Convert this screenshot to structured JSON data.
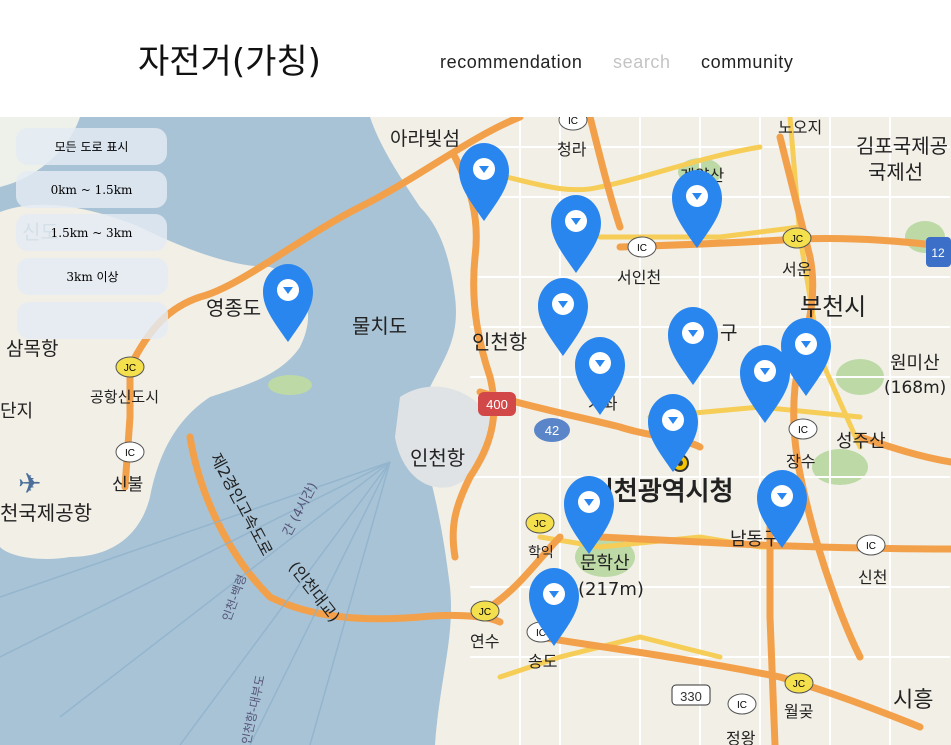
{
  "header": {
    "brand": "자전거(가칭)",
    "nav": {
      "recommendation": "recommendation",
      "search": "search",
      "community": "community"
    }
  },
  "filters": [
    "모든 도로 표시",
    "0km ~ 1.5km",
    "1.5km ~ 3km",
    "3km 이상",
    ""
  ],
  "map": {
    "labels": {
      "arabit": "아라빛섬",
      "cheongna": "청라",
      "noosiji": "노오지",
      "gimpo_airport": "김포국제공",
      "gimpo_intl": "국제선",
      "gyeyangsan": "계양산",
      "seoincheon": "서인천",
      "seoun": "서운",
      "bucheon": "부천시",
      "yeongjongdo": "영종도",
      "mulchido": "물치도",
      "incheonhang1": "인천항",
      "samokhang": "삼목항",
      "gonghang_city": "공항신도시",
      "gu": "구",
      "gajwa": "가좌",
      "wonmisan": "원미산",
      "wonmisan_height": "(168m)",
      "danji": "단지",
      "incheonhang2": "인천항",
      "seongjusan": "성주산",
      "jangsu": "장수",
      "sinbul": "신불",
      "incheon_city_hall": "인천광역시청",
      "airport_intl": "천국제공항",
      "expressway": "제2경인고속도로",
      "incheon_bridge": "(인천대교)",
      "bridge_aux": "간 (4시간)",
      "route_white": "인천-백령",
      "route_daebudo": "인천항-대부도",
      "munhaksan": "문학산",
      "munhaksan_height": "(217m)",
      "hakik": "학익",
      "namdong": "남동구",
      "sincheon": "신천",
      "yeonsu": "연수",
      "songdo": "송도",
      "wolgot": "월곶",
      "siheung": "시흥",
      "jeongwang": "정왕",
      "sindo": "신도",
      "road_400": "400",
      "road_42": "42",
      "road_330": "330",
      "road_12": "12",
      "ic": "IC",
      "jc": "JC"
    },
    "colors": {
      "sea": "#a8c3d6",
      "land": "#f2efe6",
      "green": "#bcd9a6",
      "expressway": "#f3a04a",
      "road": "#f6cd57",
      "pin": "#2a86ef"
    },
    "marker_icon": "map-pin-icon",
    "city_hall_icon": "city-hall-marker-icon"
  }
}
